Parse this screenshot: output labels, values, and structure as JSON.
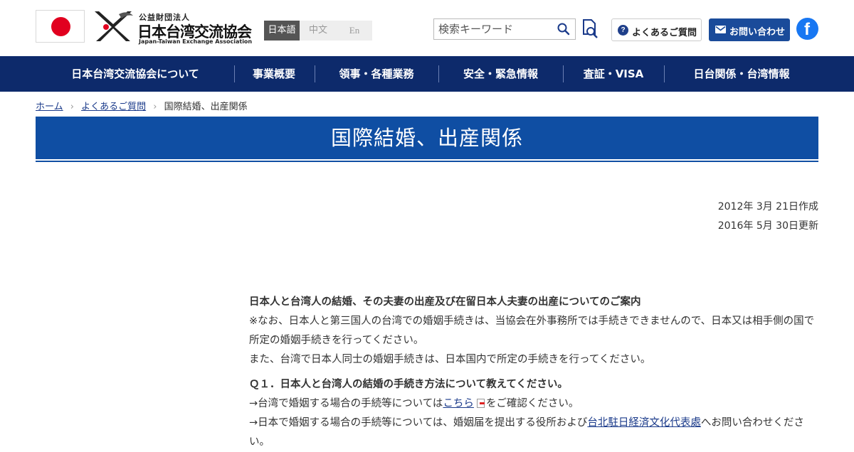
{
  "header": {
    "logo": {
      "small": "公益財団法人",
      "main": "日本台湾交流協会",
      "english": "Japan-Taiwan Exchange Association"
    },
    "languages": [
      "日本語",
      "中文",
      "En"
    ],
    "search": {
      "placeholder": "検索キーワード"
    },
    "faq_label": "よくあるご質問",
    "contact_label": "お問い合わせ",
    "facebook_glyph": "f"
  },
  "nav": {
    "items": [
      "日本台湾交流協会について",
      "事業概要",
      "領事・各種業務",
      "安全・緊急情報",
      "査証・VISA",
      "日台関係・台湾情報"
    ]
  },
  "breadcrumb": [
    "ホーム",
    "よくあるご質問",
    "国際結婚、出産関係"
  ],
  "page": {
    "title": "国際結婚、出産関係",
    "created": "2012年 3月 21日作成",
    "updated": "2016年 5月 30日更新"
  },
  "content": {
    "heading": "日本人と台湾人の結婚、その夫妻の出産及び在留日本人夫妻の出産についてのご案内",
    "note1": "※なお、日本人と第三国人の台湾での婚姻手続きは、当協会在外事務所では手続きできませんので、日本又は相手側の国で所定の婚姻手続きを行ってください。",
    "note2": "また、台湾で日本人同士の婚姻手続きは、日本国内で所定の手続きを行ってください。",
    "q1": "Ｑ１．日本人と台湾人の結婚の手続き方法について教えてください。",
    "a1_prefix": "→台湾で婚姻する場合の手続等については",
    "a1_link": "こちら",
    "a1_suffix": "をご確認ください。",
    "a2_prefix": "→日本で婚姻する場合の手続等については、婚姻届を提出する役所および",
    "a2_link": "台北駐日経済文化代表處",
    "a2_suffix": "へお問い合わせください。"
  },
  "colors": {
    "nav_bg": "#0d2a6b",
    "title_bg": "#0f4ea3",
    "contact_bg": "#1a4b9a",
    "flag_red": "#e1001f",
    "facebook": "#1877f2"
  }
}
